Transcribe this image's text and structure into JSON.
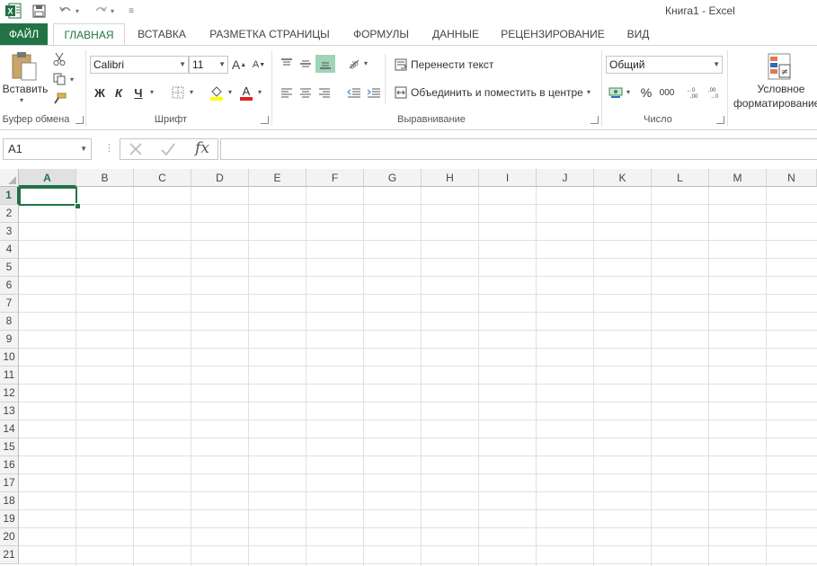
{
  "window": {
    "title": "Книга1 - Excel"
  },
  "tabs": [
    {
      "label": "ФАЙЛ"
    },
    {
      "label": "ГЛАВНАЯ"
    },
    {
      "label": "ВСТАВКА"
    },
    {
      "label": "РАЗМЕТКА СТРАНИЦЫ"
    },
    {
      "label": "ФОРМУЛЫ"
    },
    {
      "label": "ДАННЫЕ"
    },
    {
      "label": "РЕЦЕНЗИРОВАНИЕ"
    },
    {
      "label": "ВИД"
    }
  ],
  "clipboard": {
    "paste_label": "Вставить",
    "group_label": "Буфер обмена"
  },
  "font": {
    "name": "Calibri",
    "size": "11",
    "bold": "Ж",
    "italic": "К",
    "underline": "Ч",
    "group_label": "Шрифт"
  },
  "alignment": {
    "wrap_text": "Перенести текст",
    "merge_center": "Объединить и поместить в центре",
    "group_label": "Выравнивание"
  },
  "number": {
    "format": "Общий",
    "percent": "%",
    "thousands": "000",
    "group_label": "Число"
  },
  "styles": {
    "conditional_line1": "Условное",
    "conditional_line2": "форматирование"
  },
  "formula_bar": {
    "name_box": "A1",
    "fx": "fx",
    "value": ""
  },
  "columns": [
    "A",
    "B",
    "C",
    "D",
    "E",
    "F",
    "G",
    "H",
    "I",
    "J",
    "K",
    "L",
    "M",
    "N"
  ],
  "rows": [
    "1",
    "2",
    "3",
    "4",
    "5",
    "6",
    "7",
    "8",
    "9",
    "10",
    "11",
    "12",
    "13",
    "14",
    "15",
    "16",
    "17",
    "18",
    "19",
    "20",
    "21"
  ],
  "colors": {
    "accent": "#217346",
    "font_color": "#e02020",
    "highlight": "#ffff00"
  }
}
